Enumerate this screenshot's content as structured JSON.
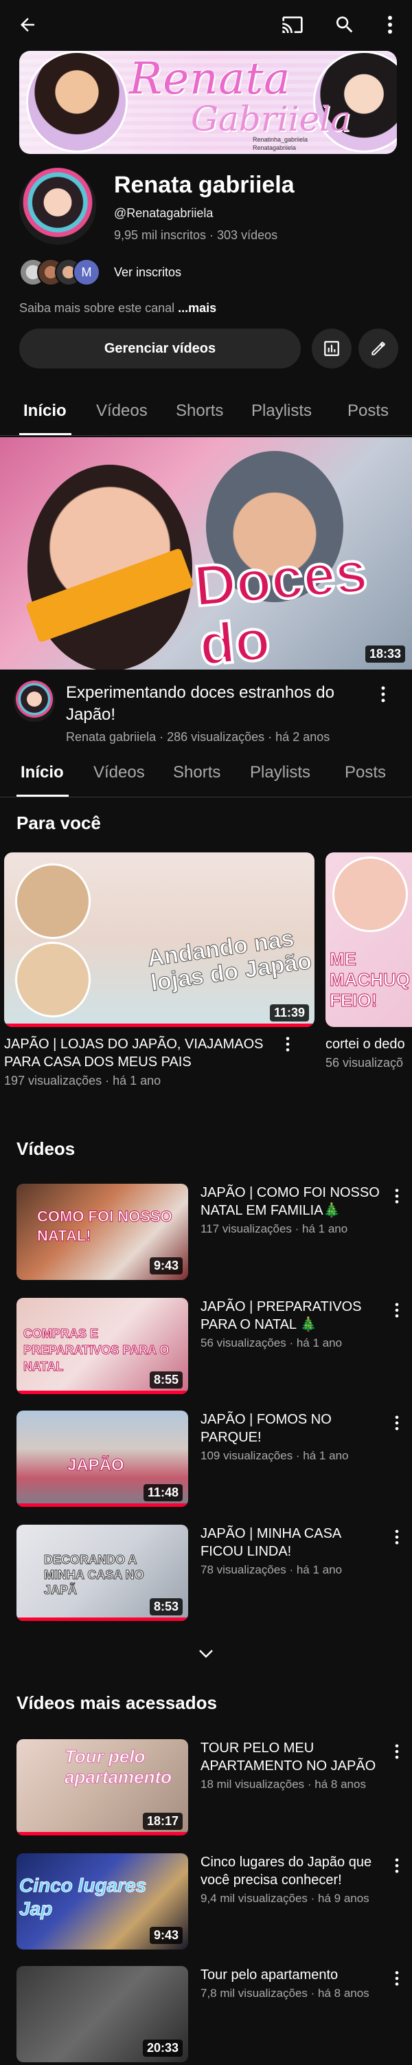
{
  "topbar": {
    "icons": [
      "back-arrow-icon",
      "cast-icon",
      "search-icon",
      "more-vert-icon"
    ]
  },
  "banner": {
    "title": "Renata",
    "subtitle": "Gabriiela",
    "line1": "Renatinha_gabriiela",
    "line2": "Renatagabriiela"
  },
  "channel": {
    "name": "Renata gabriiela",
    "handle": "@Renatagabriiela",
    "stats": "9,95 mil inscritos · 303 vídeos",
    "subs_link": "Ver inscritos",
    "subs_badge": "M",
    "about": "Saiba mais sobre este canal ",
    "about_more": "...mais",
    "manage_button": "Gerenciar vídeos"
  },
  "tabs": [
    "Início",
    "Vídeos",
    "Shorts",
    "Playlists",
    "Posts"
  ],
  "featured": {
    "overlay": "Doces do Japão",
    "duration": "18:33",
    "title": "Experimentando doces estranhos do Japão!",
    "meta": "Renata gabriiela · 286 visualizações · há 2 anos"
  },
  "for_you": {
    "heading": "Para você",
    "cards": [
      {
        "title": "JAPÃO |  LOJAS DO  JAPÃO, VIAJAMAOS PARA CASA DOS MEUS PAIS",
        "meta": "197 visualizações · há 1 ano",
        "duration": "11:39",
        "overlay": "Andando nas lojas do Japão"
      },
      {
        "title": "cortei o dedo",
        "meta": "56 visualizaçõ",
        "overlay": "ME MACHUQ FEIO!"
      }
    ]
  },
  "videos": {
    "heading": "Vídeos",
    "items": [
      {
        "title": "JAPÃO | COMO FOI NOSSO NATAL EM FAMILIA🎄",
        "meta": "117 visualizações · há 1 ano",
        "duration": "9:43",
        "overlay": "COMO FOI NOSSO NATAL!"
      },
      {
        "title": "JAPÃO | PREPARATIVOS PARA O NATAL 🎄",
        "meta": "56 visualizações · há 1 ano",
        "duration": "8:55",
        "overlay": "COMPRAS E PREPARATIVOS PARA O NATAL"
      },
      {
        "title": "JAPÃO | FOMOS NO PARQUE!",
        "meta": "109 visualizações · há 1 ano",
        "duration": "11:48",
        "overlay": "JAPÃO"
      },
      {
        "title": "JAPÃO | MINHA CASA FICOU LINDA!",
        "meta": "78 visualizações · há 1 ano",
        "duration": "8:53",
        "overlay": "DECORANDO A MINHA CASA NO JAPÃ"
      }
    ]
  },
  "most_viewed": {
    "heading": "Vídeos mais acessados",
    "items": [
      {
        "title": "TOUR PELO MEU APARTAMENTO NO JAPÃO",
        "meta": "18 mil visualizações · há 8 anos",
        "duration": "18:17",
        "overlay": "Tour pelo apartamento"
      },
      {
        "title": "Cinco lugares do Japão que você precisa conhecer!",
        "meta": "9,4 mil visualizações · há 9 anos",
        "duration": "9:43",
        "overlay": "Cinco lugares Jap"
      },
      {
        "title": "Tour pelo apartamento",
        "meta": "7,8 mil visualizações · há 8 anos",
        "duration": "20:33"
      }
    ]
  },
  "colors": {
    "background": "#0f0f0f",
    "surface": "#272727",
    "text_secondary": "#aaaaaa",
    "progress": "#ff0033"
  }
}
